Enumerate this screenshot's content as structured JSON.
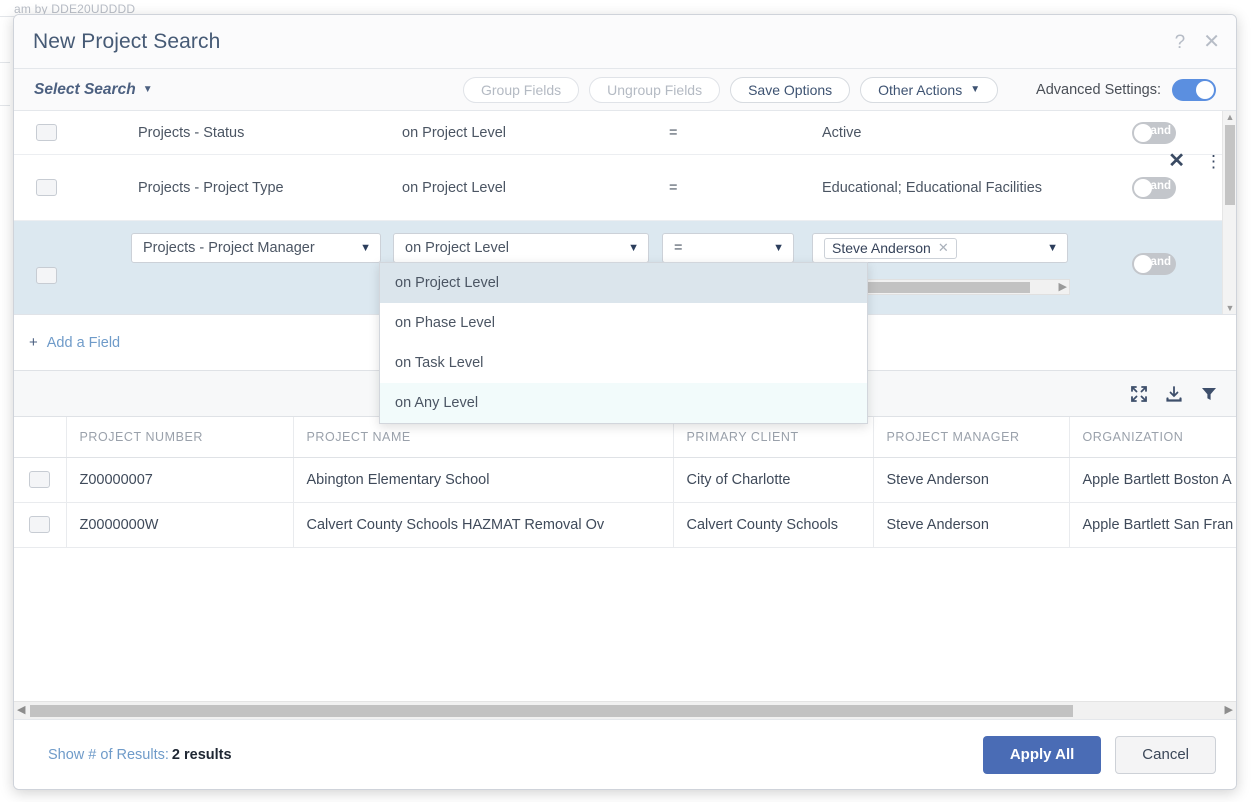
{
  "background": {
    "text": "am by DDE20UDDDD"
  },
  "modal": {
    "title": "New Project Search",
    "help_icon": "question-mark-icon",
    "close_icon": "close-icon"
  },
  "toolbar": {
    "select_search": "Select Search",
    "buttons": [
      {
        "label": "Group Fields",
        "disabled": true
      },
      {
        "label": "Ungroup Fields",
        "disabled": true
      },
      {
        "label": "Save Options",
        "disabled": false
      },
      {
        "label": "Other Actions",
        "disabled": false,
        "caret": true
      }
    ],
    "advanced_settings_label": "Advanced Settings:",
    "advanced_settings_on": true
  },
  "criteria": {
    "rows": [
      {
        "field": "Projects - Status",
        "level": "on Project Level",
        "operator": "=",
        "value": "Active",
        "conjunction": "and"
      },
      {
        "field": "Projects - Project Type",
        "level": "on Project Level",
        "operator": "=",
        "value": "Educational; Educational Facilities",
        "conjunction": "and"
      },
      {
        "field": "Projects - Project Manager",
        "level": "on Project Level",
        "operator": "=",
        "value_chip": "Steve Anderson",
        "conjunction": "and",
        "active": true
      }
    ],
    "level_options": [
      {
        "label": "on Project Level",
        "state": "selected"
      },
      {
        "label": "on Phase Level",
        "state": "normal"
      },
      {
        "label": "on Task Level",
        "state": "normal"
      },
      {
        "label": "on Any Level",
        "state": "hovered"
      }
    ],
    "add_field_label": "Add a Field",
    "add_field_plus": "+",
    "remove_icon": "close-icon",
    "more_icon": "more-vertical-icon"
  },
  "results": {
    "tools": [
      {
        "name": "expand-icon"
      },
      {
        "name": "download-icon"
      },
      {
        "name": "filter-icon"
      }
    ],
    "columns": [
      "PROJECT NUMBER",
      "PROJECT NAME",
      "PRIMARY CLIENT",
      "PROJECT MANAGER",
      "ORGANIZATION"
    ],
    "rows": [
      {
        "project_number": "Z00000007",
        "project_name": "Abington Elementary School",
        "primary_client": "City of Charlotte",
        "project_manager": "Steve Anderson",
        "organization": "Apple Bartlett Boston A"
      },
      {
        "project_number": "Z0000000W",
        "project_name": "Calvert County Schools HAZMAT Removal Ov",
        "primary_client": "Calvert County Schools",
        "project_manager": "Steve Anderson",
        "organization": "Apple Bartlett San Fran"
      }
    ]
  },
  "footer": {
    "results_label": "Show # of Results:",
    "results_count": "2 results",
    "apply_label": "Apply All",
    "cancel_label": "Cancel"
  },
  "colors": {
    "accent_blue": "#4a6cb5",
    "toggle_on": "#5b8fe0",
    "link": "#6f9bc9",
    "active_row": "#dce8f0"
  }
}
